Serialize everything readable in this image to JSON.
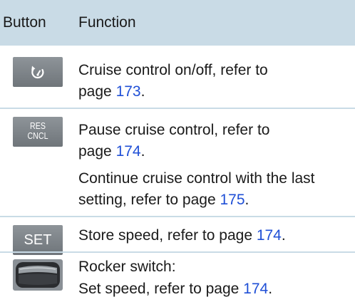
{
  "header": {
    "col_button": "Button",
    "col_function": "Function"
  },
  "rows": [
    {
      "icon": "cruise-control-icon",
      "line1": "Cruise control on/off, refer to",
      "line2_prefix": "page ",
      "line2_link": "173",
      "line2_suffix": "."
    },
    {
      "icon": "res-cncl-icon",
      "icon_text_top": "RES",
      "icon_text_bottom": "CNCL",
      "line1": "Pause cruise control, refer to",
      "line2_prefix": "page ",
      "line2_link": "174",
      "line2_suffix": ".",
      "line3": "Continue cruise control with the last",
      "line4_prefix": "setting, refer to page ",
      "line4_link": "175",
      "line4_suffix": "."
    },
    {
      "icon": "set-icon",
      "icon_text": "SET",
      "line1_prefix": "Store speed, refer to page ",
      "line1_link": "174",
      "line1_suffix": "."
    },
    {
      "icon": "rocker-switch-icon",
      "line1": "Rocker switch:",
      "line2_prefix": "Set speed, refer to page ",
      "line2_link": "174",
      "line2_suffix": "."
    }
  ],
  "colors": {
    "header_bg": "#c9dbe6",
    "link": "#1f4fd6",
    "icon_bg": "#7d8388"
  }
}
